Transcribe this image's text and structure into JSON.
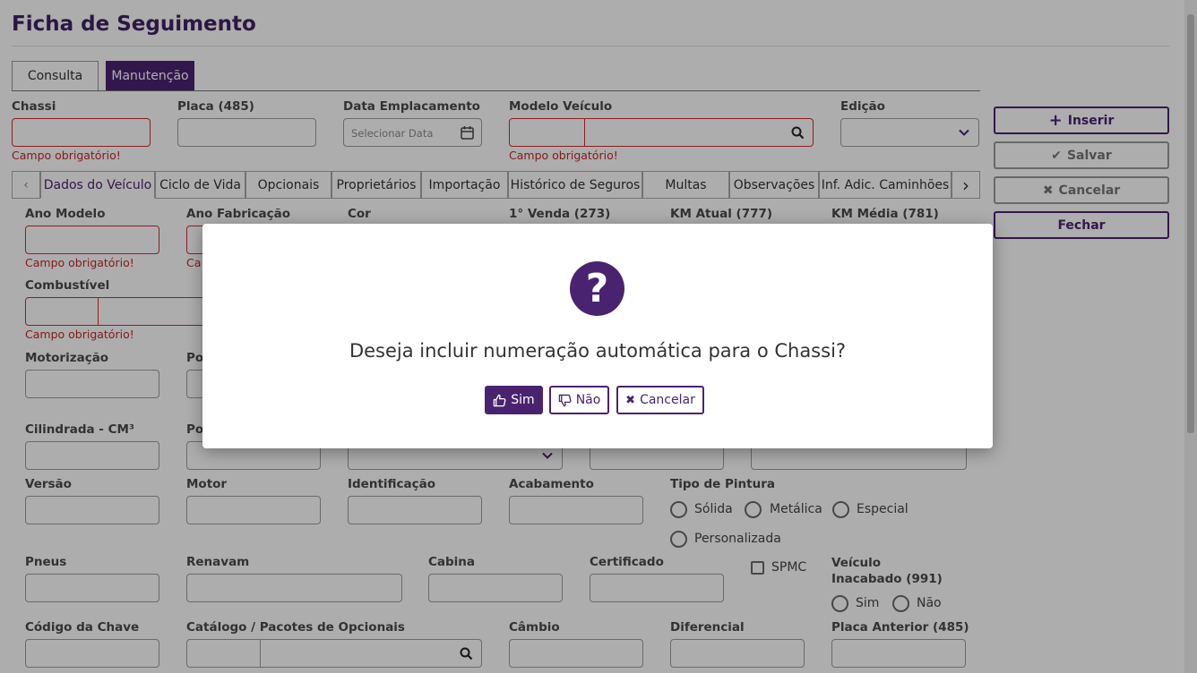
{
  "page_title": "Ficha de Seguimento",
  "tabs": [
    {
      "label": "Consulta"
    },
    {
      "label": "Manutenção"
    }
  ],
  "header_fields": {
    "chassi_label": "Chassi",
    "placa_label": "Placa (485)",
    "data_emplacamento_label": "Data Emplacamento",
    "data_placeholder": "Selecionar Data",
    "modelo_label": "Modelo Veículo",
    "edicao_label": "Edição",
    "required_msg": "Campo obrigatório!"
  },
  "actions": {
    "inserir": "Inserir",
    "salvar": "Salvar",
    "cancelar": "Cancelar",
    "fechar": "Fechar"
  },
  "subtabs": [
    {
      "label": "Dados do Veículo"
    },
    {
      "label": "Ciclo de Vida"
    },
    {
      "label": "Opcionais"
    },
    {
      "label": "Proprietários"
    },
    {
      "label": "Importação"
    },
    {
      "label": "Histórico de Seguros"
    },
    {
      "label": "Multas"
    },
    {
      "label": "Observações"
    },
    {
      "label": "Inf. Adic. Caminhões"
    }
  ],
  "fields": {
    "ano_modelo": "Ano Modelo",
    "ano_fabricacao": "Ano Fabricação",
    "cor": "Cor",
    "primeira_venda": "1° Venda (273)",
    "km_atual": "KM Atual (777)",
    "km_media": "KM Média (781)",
    "combustivel": "Combustível",
    "motorizacao": "Motorização",
    "po_partial": "Po",
    "cilindrada": "Cilindrada - CM³",
    "pot_partial": "Pot",
    "versao": "Versão",
    "motor": "Motor",
    "identificacao": "Identificação",
    "acabamento": "Acabamento",
    "tipo_pintura": "Tipo de Pintura",
    "pneus": "Pneus",
    "renavam": "Renavam",
    "cabina": "Cabina",
    "certificado": "Certificado",
    "spmc": "SPMC",
    "veiculo_inacabado": "Veículo Inacabado (991)",
    "codigo_chave": "Código da Chave",
    "catalogo": "Catálogo / Pacotes de Opcionais",
    "cambio": "Câmbio",
    "diferencial": "Diferencial",
    "placa_anterior": "Placa Anterior (485)",
    "partial_error": "Ca"
  },
  "pintura_options": [
    "Sólida",
    "Metálica",
    "Especial",
    "Personalizada"
  ],
  "inacabado_options": [
    "Sim",
    "Não"
  ],
  "modal": {
    "message": "Deseja incluir numeração automática para o Chassi?",
    "sim": "Sim",
    "nao": "Não",
    "cancelar": "Cancelar"
  }
}
